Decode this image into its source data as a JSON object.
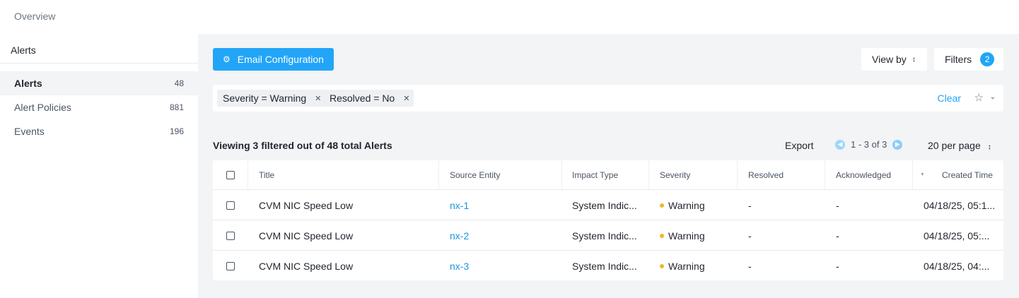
{
  "topbar": {
    "overview": "Overview"
  },
  "sidebar": {
    "heading": "Alerts",
    "items": [
      {
        "label": "Alerts",
        "count": "48",
        "active": true
      },
      {
        "label": "Alert Policies",
        "count": "881",
        "active": false
      },
      {
        "label": "Events",
        "count": "196",
        "active": false
      }
    ]
  },
  "toolbar": {
    "email_config_label": "Email Configuration",
    "email_config_icon": "gear-icon",
    "view_by_label": "View by",
    "filters_label": "Filters",
    "filters_count": "2"
  },
  "filterbar": {
    "chips": [
      {
        "label": "Severity = Warning"
      },
      {
        "label": "Resolved = No"
      }
    ],
    "clear_label": "Clear"
  },
  "summary": {
    "viewing_text": "Viewing 3 filtered out of 48 total Alerts",
    "export_label": "Export",
    "page_range": "1 - 3 of 3",
    "per_page": "20 per page"
  },
  "table": {
    "columns": [
      "Title",
      "Source Entity",
      "Impact Type",
      "Severity",
      "Resolved",
      "Acknowledged",
      "Created Time"
    ],
    "rows": [
      {
        "title": "CVM NIC Speed Low",
        "source": "nx-1",
        "impact": "System Indic...",
        "severity": "Warning",
        "resolved": "-",
        "acknowledged": "-",
        "created": "04/18/25, 05:1..."
      },
      {
        "title": "CVM NIC Speed Low",
        "source": "nx-2",
        "impact": "System Indic...",
        "severity": "Warning",
        "resolved": "-",
        "acknowledged": "-",
        "created": "04/18/25, 05:..."
      },
      {
        "title": "CVM NIC Speed Low",
        "source": "nx-3",
        "impact": "System Indic...",
        "severity": "Warning",
        "resolved": "-",
        "acknowledged": "-",
        "created": "04/18/25, 04:..."
      }
    ]
  },
  "colors": {
    "accent": "#22a5f7",
    "warning": "#f0b429",
    "link": "#1e94e0"
  }
}
